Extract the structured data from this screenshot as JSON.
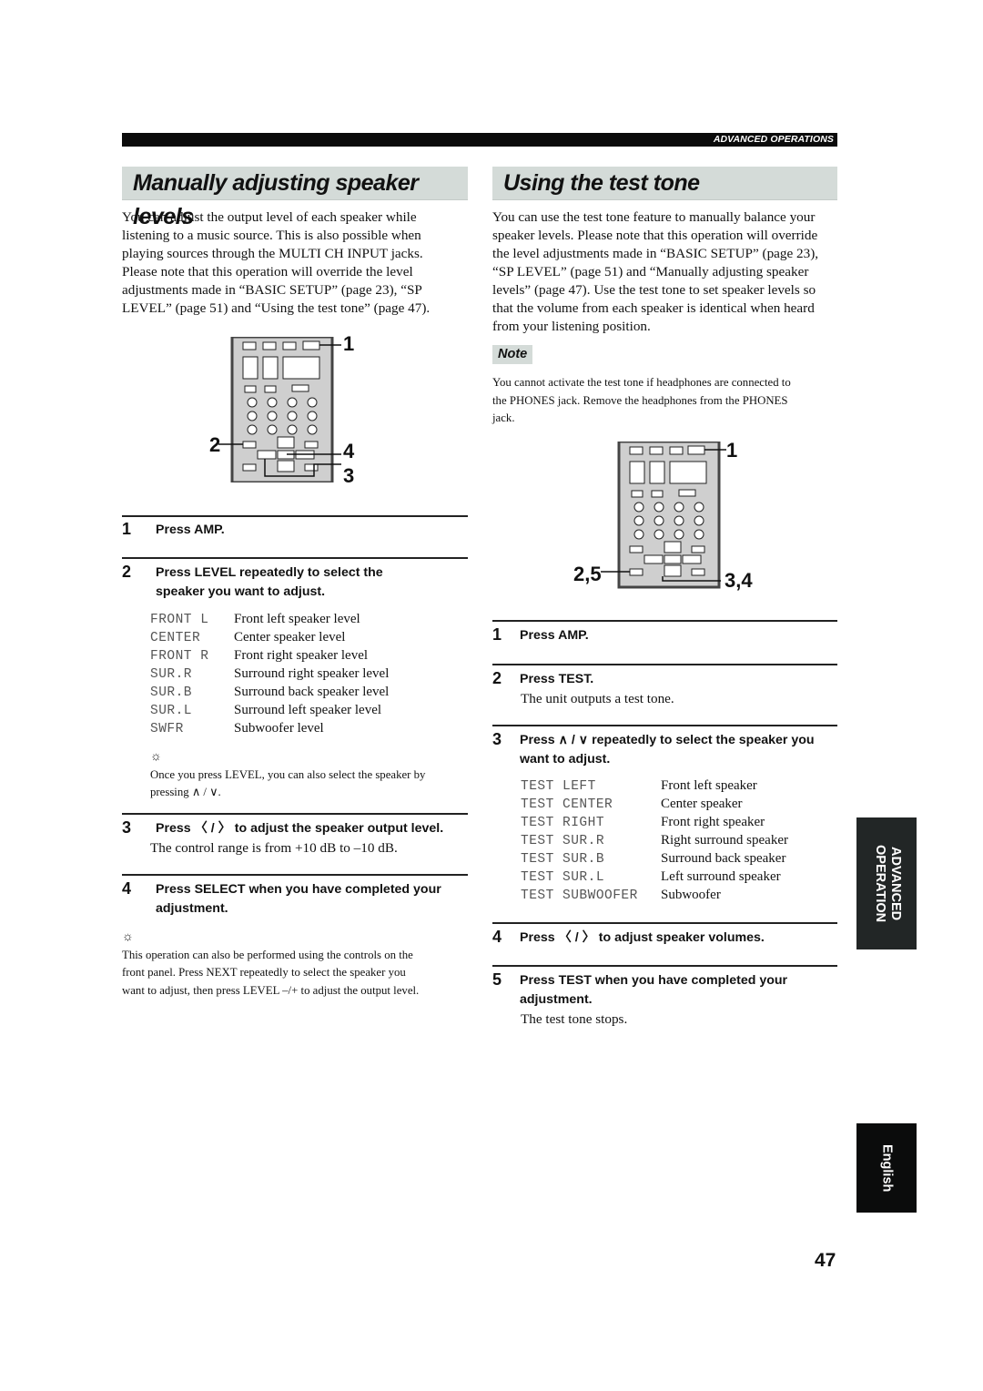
{
  "header": {
    "section_label": "ADVANCED OPERATIONS"
  },
  "left": {
    "title": "Manually adjusting speaker levels",
    "intro_lines": [
      "You can adjust the output level of each speaker while",
      "listening to a music source. This is also possible when",
      "playing sources through the MULTI CH INPUT jacks.",
      "Please note that this operation will override the level",
      "adjustments made in “BASIC SETUP” (page 23), “SP",
      "LEVEL” (page 51) and “Using the test tone” (page 47)."
    ],
    "remote_callouts": {
      "c1": "1",
      "c2": "2",
      "c4": "4",
      "c3": "3"
    },
    "steps": [
      {
        "num": "1",
        "text": "Press AMP."
      },
      {
        "num": "2",
        "text": "Press LEVEL repeatedly to select the speaker you want to adjust."
      },
      {
        "num": "3",
        "text": "Press 〈 / 〉 to adjust the speaker output level.",
        "detail": "The control range is from +10 dB to –10 dB."
      },
      {
        "num": "4",
        "text": "Press SELECT when you have completed your adjustment."
      }
    ],
    "level_table": [
      {
        "display": "FRONT L",
        "desc": "Front left speaker level"
      },
      {
        "display": "CENTER",
        "desc": "Center speaker level"
      },
      {
        "display": "FRONT R",
        "desc": "Front right speaker level"
      },
      {
        "display": "SUR.R",
        "desc": "Surround right speaker level"
      },
      {
        "display": "SUR.B",
        "desc": "Surround back speaker level"
      },
      {
        "display": "SUR.L",
        "desc": "Surround left speaker level"
      },
      {
        "display": "SWFR",
        "desc": "Subwoofer level"
      }
    ],
    "tip1": {
      "icon": "tip-icon",
      "lines": [
        "Once you press LEVEL, you can also select the speaker by",
        "pressing ∧ / ∨."
      ]
    },
    "tip2": {
      "icon": "tip-icon",
      "lines": [
        "This operation can also be performed using the controls on the",
        "front panel. Press NEXT repeatedly to select the speaker you",
        "want to adjust, then press LEVEL –/+ to adjust the output level."
      ]
    }
  },
  "right": {
    "title": "Using the test tone",
    "intro_lines": [
      "You can use the test tone feature to manually balance your",
      "speaker levels. Please note that this operation will override",
      "the level adjustments made in “BASIC SETUP” (page 23),",
      "“SP LEVEL” (page 51) and “Manually adjusting speaker",
      "levels” (page 47). Use the test tone to set speaker levels so",
      "that the volume from each speaker is identical when heard",
      "from your listening position."
    ],
    "note": {
      "label": "Note",
      "lines": [
        "You cannot activate the test tone if headphones are connected to",
        "the PHONES jack. Remove the headphones from the PHONES",
        "jack."
      ]
    },
    "remote_callouts": {
      "c1": "1",
      "c25": "2,5",
      "c34": "3,4"
    },
    "steps": [
      {
        "num": "1",
        "text": "Press AMP."
      },
      {
        "num": "2",
        "text": "Press TEST.",
        "detail": "The unit outputs a test tone."
      },
      {
        "num": "3",
        "text": "Press ∧ / ∨ repeatedly to select the speaker you want to adjust."
      },
      {
        "num": "4",
        "text": "Press 〈 / 〉 to adjust speaker volumes."
      },
      {
        "num": "5",
        "text": "Press TEST when you have completed your adjustment.",
        "detail": "The test tone stops."
      }
    ],
    "test_table": [
      {
        "display": "TEST LEFT",
        "desc": "Front left speaker"
      },
      {
        "display": "TEST CENTER",
        "desc": "Center speaker"
      },
      {
        "display": "TEST RIGHT",
        "desc": "Front right speaker"
      },
      {
        "display": "TEST SUR.R",
        "desc": "Right surround speaker"
      },
      {
        "display": "TEST SUR.B",
        "desc": "Surround back speaker"
      },
      {
        "display": "TEST SUR.L",
        "desc": "Left surround speaker"
      },
      {
        "display": "TEST SUBWOOFER",
        "desc": "Subwoofer"
      }
    ]
  },
  "side_tabs": {
    "advanced": "ADVANCED OPERATION",
    "english": "English"
  },
  "page_number": "47"
}
